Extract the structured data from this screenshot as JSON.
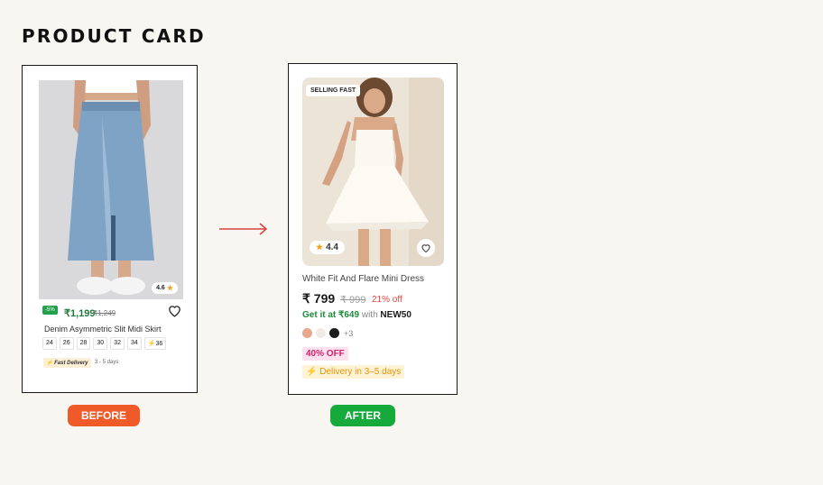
{
  "page": {
    "heading": "PRODUCT CARD"
  },
  "before": {
    "rating": "4.6",
    "discount": "-5%",
    "price": "₹1,199",
    "mrp": "₹1,249",
    "title": "Denim Asymmetric Slit Midi Skirt",
    "sizes": [
      "24",
      "26",
      "28",
      "30",
      "32",
      "34",
      "36"
    ],
    "fast_delivery": "Fast Delivery",
    "delivery_days": "3 - 5 days",
    "tag": "BEFORE"
  },
  "after": {
    "badge": "SELLING FAST",
    "rating": "4.4",
    "title": "White Fit And Flare Mini Dress",
    "price": "₹ 799",
    "mrp": "₹ 999",
    "off": "21% off",
    "offer_prefix": "Get it at ₹649",
    "offer_with": "with",
    "offer_code": "NEW50",
    "swatches": [
      "#e9a88e",
      "#f1ebe6",
      "#1b1b1b"
    ],
    "more_colors": "+3",
    "discount_badge": "40% OFF",
    "delivery": "⚡ Delivery in 3–5 days",
    "tag": "AFTER"
  },
  "colors": {
    "accent_before": "#f05a28",
    "accent_after": "#16a93c",
    "arrow": "#d9403a"
  }
}
